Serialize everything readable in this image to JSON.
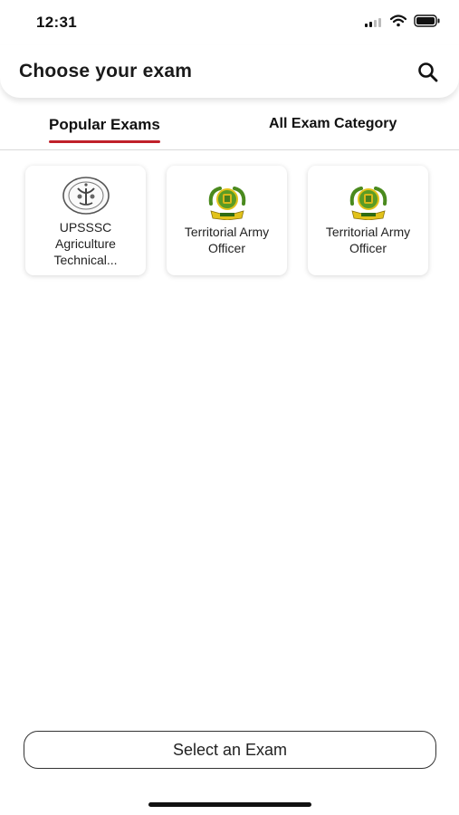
{
  "status_bar": {
    "time": "12:31",
    "icons": [
      "signal-icon",
      "wifi-icon",
      "battery-icon"
    ]
  },
  "header": {
    "title": "Choose your exam",
    "search_icon": "search-icon"
  },
  "tabs": [
    {
      "label": "Popular Exams",
      "active": true
    },
    {
      "label": "All Exam Category",
      "active": false
    }
  ],
  "accent_color": "#c0202a",
  "exams": [
    {
      "label": "UPSSSC Agriculture Technical...",
      "logo": "upsssc-emblem-icon"
    },
    {
      "label": "Territorial Army Officer",
      "logo": "territorial-army-emblem-icon"
    },
    {
      "label": "Territorial Army Officer",
      "logo": "territorial-army-emblem-icon"
    }
  ],
  "footer": {
    "select_label": "Select an Exam"
  }
}
